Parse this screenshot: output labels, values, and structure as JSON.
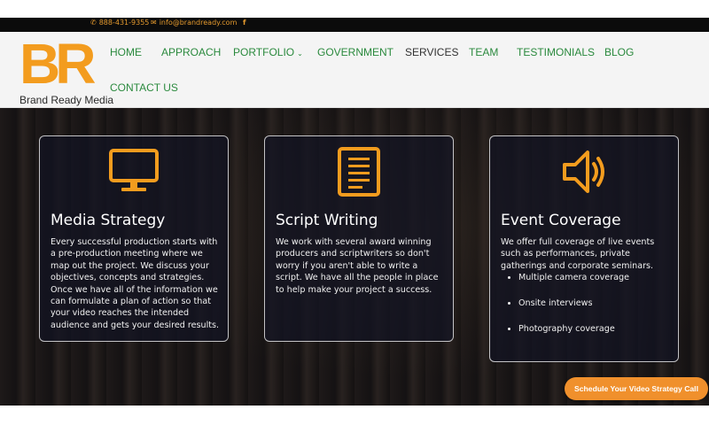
{
  "topbar": {
    "phone": "888-431-9355",
    "email": "info@brandready.com",
    "facebook_glyph": "f",
    "accent_color": "#e59a2e"
  },
  "logo": {
    "mark": "BR",
    "name": "Brand Ready Media",
    "color": "#f39c1e"
  },
  "nav": {
    "items": [
      {
        "label": "HOME"
      },
      {
        "label": "APPROACH"
      },
      {
        "label": "PORTFOLIO",
        "chevron": "⌄"
      },
      {
        "label": "GOVERNMENT"
      },
      {
        "label": "SERVICES",
        "active": true
      },
      {
        "label": "TEAM"
      },
      {
        "label": "TESTIMONIALS"
      },
      {
        "label": "BLOG"
      },
      {
        "label": "CONTACT US"
      }
    ],
    "color": "#2b8a3e"
  },
  "cards": [
    {
      "icon": "monitor-icon",
      "title": "Media Strategy",
      "body": "Every successful production starts with a pre-production meeting where we map out the project. We discuss your objectives, concepts and strategies. Once we have all of the information we can formulate a plan of action so that your video reaches the intended audience and gets your desired results."
    },
    {
      "icon": "document-icon",
      "title": "Script Writing",
      "body": "We work with several award winning producers and scriptwriters so don't worry if you aren't able to write a script. We have all the people in place to help make your project a success."
    },
    {
      "icon": "speaker-icon",
      "title": "Event Coverage",
      "body": "We offer full coverage of live events such as performances, private gatherings and corporate seminars.",
      "bullets": [
        "Multiple camera coverage",
        "Onsite interviews",
        "Photography coverage"
      ]
    }
  ],
  "cta": {
    "label": "Schedule Your Video Strategy Call",
    "color": "#f0902c"
  },
  "icon_color": "#f39c1e"
}
